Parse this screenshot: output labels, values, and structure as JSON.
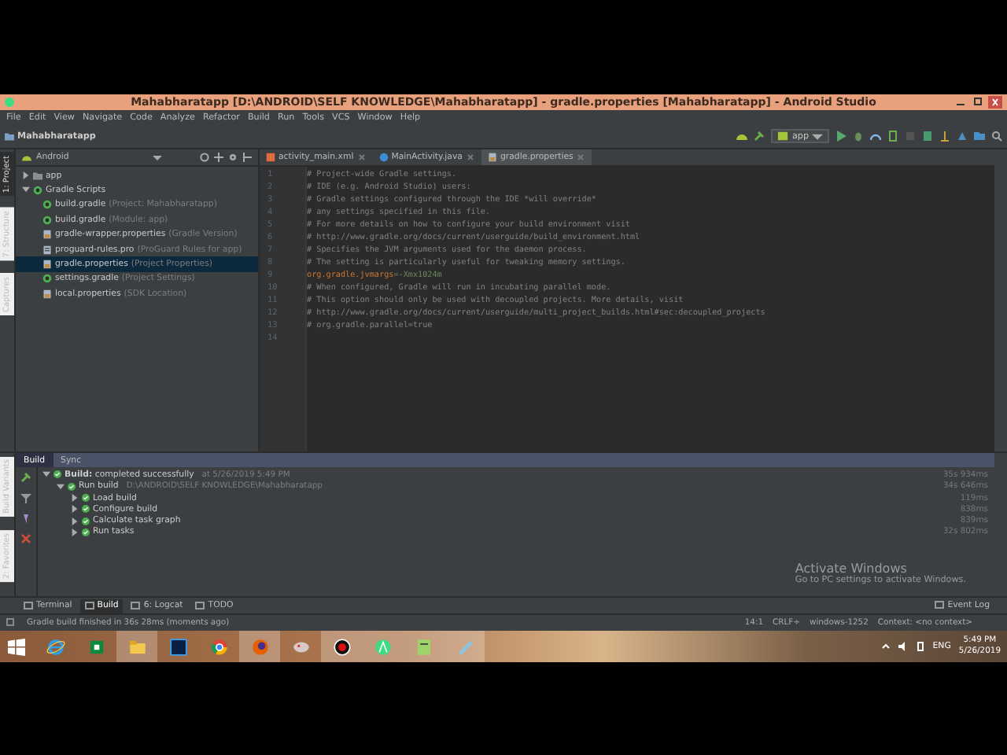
{
  "window": {
    "title": "Mahabharatapp [D:\\ANDROID\\SELF KNOWLEDGE\\Mahabharatapp] - gradle.properties [Mahabharatapp] - Android Studio"
  },
  "menu": [
    "File",
    "Edit",
    "View",
    "Navigate",
    "Code",
    "Analyze",
    "Refactor",
    "Build",
    "Run",
    "Tools",
    "VCS",
    "Window",
    "Help"
  ],
  "navbar": {
    "project": "Mahabharatapp",
    "run_config": "app"
  },
  "left_strip": [
    {
      "label": "1: Project",
      "selected": true
    },
    {
      "label": "7: Structure",
      "selected": false
    },
    {
      "label": "Captures",
      "selected": false
    }
  ],
  "project_panel": {
    "view": "Android",
    "tree": [
      {
        "label": "app",
        "kind": "folder",
        "expanded": false,
        "selected": false
      },
      {
        "label": "Gradle Scripts",
        "kind": "gradle",
        "expanded": true,
        "selected": false,
        "children": [
          {
            "label": "build.gradle",
            "hint": "(Project: Mahabharatapp)",
            "kind": "gradle",
            "selected": false
          },
          {
            "label": "build.gradle",
            "hint": "(Module: app)",
            "kind": "gradle",
            "selected": false
          },
          {
            "label": "gradle-wrapper.properties",
            "hint": "(Gradle Version)",
            "kind": "properties",
            "selected": false
          },
          {
            "label": "proguard-rules.pro",
            "hint": "(ProGuard Rules for app)",
            "kind": "file",
            "selected": false
          },
          {
            "label": "gradle.properties",
            "hint": "(Project Properties)",
            "kind": "properties",
            "selected": true
          },
          {
            "label": "settings.gradle",
            "hint": "(Project Settings)",
            "kind": "gradle",
            "selected": false
          },
          {
            "label": "local.properties",
            "hint": "(SDK Location)",
            "kind": "properties",
            "selected": false
          }
        ]
      }
    ]
  },
  "editor": {
    "tabs": [
      {
        "label": "activity_main.xml",
        "kind": "xml",
        "selected": false
      },
      {
        "label": "MainActivity.java",
        "kind": "java",
        "selected": false
      },
      {
        "label": "gradle.properties",
        "kind": "properties",
        "selected": true
      }
    ],
    "lines": [
      {
        "number": "1",
        "kind": "comment",
        "text": "# Project-wide Gradle settings."
      },
      {
        "number": "2",
        "kind": "comment",
        "text": "# IDE (e.g. Android Studio) users:"
      },
      {
        "number": "3",
        "kind": "comment",
        "text": "# Gradle settings configured through the IDE *will override*"
      },
      {
        "number": "4",
        "kind": "comment",
        "text": "# any settings specified in this file."
      },
      {
        "number": "5",
        "kind": "comment",
        "text": "# For more details on how to configure your build environment visit"
      },
      {
        "number": "6",
        "kind": "comment",
        "text": "# http://www.gradle.org/docs/current/userguide/build_environment.html"
      },
      {
        "number": "7",
        "kind": "comment",
        "text": "# Specifies the JVM arguments used for the daemon process."
      },
      {
        "number": "8",
        "kind": "comment",
        "text": "# The setting is particularly useful for tweaking memory settings."
      },
      {
        "number": "9",
        "kind": "property",
        "key": "org.gradle.jvmargs",
        "value": "=-Xmx1024m"
      },
      {
        "number": "10",
        "kind": "comment",
        "text": "# When configured, Gradle will run in incubating parallel mode."
      },
      {
        "number": "11",
        "kind": "comment",
        "text": "# This option should only be used with decoupled projects. More details, visit"
      },
      {
        "number": "12",
        "kind": "comment",
        "text": "# http://www.gradle.org/docs/current/userguide/multi_project_builds.html#sec:decoupled_projects"
      },
      {
        "number": "13",
        "kind": "comment",
        "text": "# org.gradle.parallel=true"
      },
      {
        "number": "14",
        "kind": "empty"
      }
    ]
  },
  "build_strip": [
    {
      "label": "Build Variants"
    },
    {
      "label": "2: Favorites"
    }
  ],
  "build_panel": {
    "tabs": [
      {
        "label": "Build",
        "selected": true
      },
      {
        "label": "Sync",
        "selected": false
      }
    ],
    "tree": [
      {
        "label": "**Build:** completed successfully",
        "detail": "at 5/26/2019 5:49 PM",
        "time": "35s 934ms",
        "expanded": true,
        "children": [
          {
            "label": "Run build",
            "detail": "D:\\ANDROID\\SELF KNOWLEDGE\\Mahabharatapp",
            "time": "34s 646ms",
            "expanded": true,
            "children": [
              {
                "label": "Load build",
                "time": "119ms",
                "expanded": false
              },
              {
                "label": "Configure build",
                "time": "838ms",
                "expanded": false
              },
              {
                "label": "Calculate task graph",
                "time": "839ms",
                "expanded": false
              },
              {
                "label": "Run tasks",
                "time": "32s 802ms",
                "expanded": false
              }
            ]
          }
        ]
      }
    ]
  },
  "bottom_tabs": [
    {
      "label": "Terminal",
      "selected": false
    },
    {
      "label": "Build",
      "selected": true
    },
    {
      "label": "6: Logcat",
      "selected": false
    },
    {
      "label": "TODO",
      "selected": false
    }
  ],
  "event_log": "Event Log",
  "activation": {
    "title": "Activate Windows",
    "text": "Go to PC settings to activate Windows."
  },
  "status_bar": {
    "message": "Gradle build finished in 36s 28ms (moments ago)",
    "position": "14:1",
    "line_sep": "CRLF÷",
    "encoding": "windows-1252",
    "context": "Context: <no context>"
  },
  "taskbar": {
    "apps": [
      {
        "kind": "ie",
        "active": false
      },
      {
        "kind": "store",
        "active": false
      },
      {
        "kind": "explorer",
        "active": true
      },
      {
        "kind": "photoshop",
        "active": false
      },
      {
        "kind": "chrome",
        "active": false
      },
      {
        "kind": "firefox",
        "active": true
      },
      {
        "kind": "paint",
        "active": false
      },
      {
        "kind": "record",
        "active": true
      },
      {
        "kind": "android",
        "active": true
      },
      {
        "kind": "notepad",
        "active": true
      },
      {
        "kind": "note",
        "active": true
      }
    ],
    "language": "ENG",
    "time": "5:49 PM",
    "date": "5/26/2019"
  }
}
